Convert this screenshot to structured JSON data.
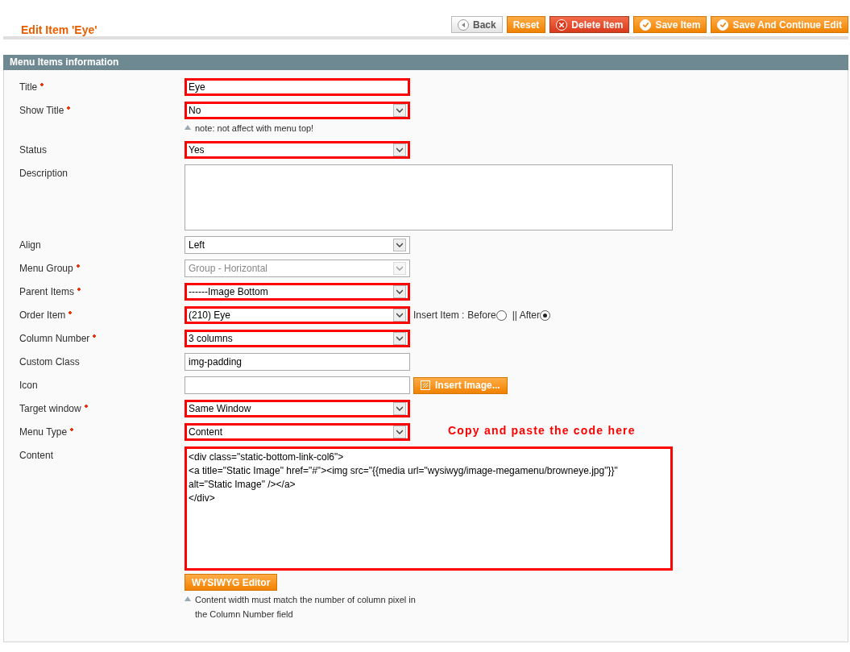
{
  "header": {
    "title": "Edit Item 'Eye'",
    "buttons": [
      {
        "label": "Back",
        "kind": "back"
      },
      {
        "label": "Reset",
        "kind": "plain"
      },
      {
        "label": "Delete Item",
        "kind": "delete"
      },
      {
        "label": "Save Item",
        "kind": "save"
      },
      {
        "label": "Save And Continue Edit",
        "kind": "save"
      }
    ]
  },
  "section": {
    "title": "Menu Items information"
  },
  "fields": [
    {
      "label": "Title",
      "required": true,
      "kind": "text",
      "value": "Eye",
      "highlighted": true
    },
    {
      "label": "Show Title",
      "required": true,
      "kind": "select",
      "value": "No",
      "highlighted": true,
      "note": "note: not affect with menu top!"
    },
    {
      "label": "Status",
      "required": false,
      "kind": "select",
      "value": "Yes",
      "highlighted": true
    },
    {
      "label": "Description",
      "required": false,
      "kind": "textarea",
      "highlighted": false
    },
    {
      "label": "Align",
      "required": false,
      "kind": "select",
      "value": "Left",
      "highlighted": false
    },
    {
      "label": "Menu Group",
      "required": true,
      "kind": "select",
      "value": "Group - Horizontal",
      "highlighted": false,
      "disabled": true
    },
    {
      "label": "Parent Items",
      "required": true,
      "kind": "select",
      "value": "------Image Bottom",
      "highlighted": true
    },
    {
      "label": "Order Item",
      "required": true,
      "kind": "select",
      "value": "(210) Eye",
      "highlighted": true,
      "insert": {
        "label": "Insert Item :",
        "options": [
          {
            "label": "Before",
            "selected": false
          },
          {
            "label": "|| After",
            "selected": true
          }
        ]
      }
    },
    {
      "label": "Column Number",
      "required": true,
      "kind": "select",
      "value": "3 columns",
      "highlighted": true
    },
    {
      "label": "Custom Class",
      "required": false,
      "kind": "text",
      "value": "img-padding",
      "highlighted": false
    },
    {
      "label": "Icon",
      "required": false,
      "kind": "text",
      "highlighted": false,
      "button": "Insert Image..."
    },
    {
      "label": "Target window",
      "required": true,
      "kind": "select",
      "value": "Same Window",
      "highlighted": true
    },
    {
      "label": "Menu Type",
      "required": true,
      "kind": "select",
      "value": "Content",
      "highlighted": true,
      "annotation": "Copy and paste the code here"
    },
    {
      "label": "Content",
      "required": false,
      "kind": "code",
      "value": "<div class=\"static-bottom-link-col6\">\n<a title=\"Static Image\" href=\"#\"><img src=\"{{media url=\"wysiwyg/image-megamenu/browneye.jpg\"}}\"\nalt=\"Static Image\" /></a>\n</div>",
      "highlighted": true,
      "button": "WYSIWYG Editor",
      "note": "Content width must match the number of column pixel in the Column Number field"
    }
  ]
}
